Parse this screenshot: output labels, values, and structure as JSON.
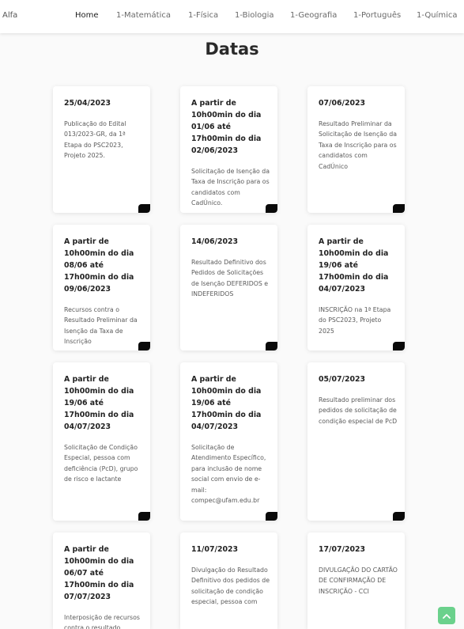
{
  "nav": {
    "brand": "Alfa",
    "links": [
      "Home",
      "1-Matemática",
      "1-Física",
      "1-Biologia",
      "1-Geografia",
      "1-Português",
      "1-Química"
    ]
  },
  "page": {
    "title": "Datas"
  },
  "cards": [
    {
      "date": "25/04/2023",
      "desc": "Publicação do Edital 013/2023-GR, da 1ª Etapa do PSC2023, Projeto 2025."
    },
    {
      "date": "A partir de 10h00min do dia 01/06 até 17h00min do dia 02/06/2023",
      "desc": "Solicitação de Isenção da Taxa de Inscrição para os candidatos com CadÚnico."
    },
    {
      "date": "07/06/2023",
      "desc": "Resultado Preliminar da Solicitação de Isenção da Taxa de Inscrição para os candidatos com CadÚnico"
    },
    {
      "date": "A partir de 10h00min do dia 08/06 até 17h00min do dia 09/06/2023",
      "desc": "Recursos contra o Resultado Preliminar da Isenção da Taxa de Inscrição"
    },
    {
      "date": "14/06/2023",
      "desc": "Resultado Definitivo dos Pedidos de Solicitações de Isenção DEFERIDOS e INDEFERIDOS"
    },
    {
      "date": "A partir de 10h00min do dia 19/06 até 17h00min do dia 04/07/2023",
      "desc": "INSCRIÇÃO na 1ª Etapa do PSC2023, Projeto 2025"
    },
    {
      "date": "A partir de 10h00min do dia 19/06 até 17h00min do dia 04/07/2023",
      "desc": "Solicitação de Condição Especial, pessoa com deficiência (PcD), grupo de risco e lactante"
    },
    {
      "date": "A partir de 10h00min do dia 19/06 até 17h00min do dia 04/07/2023",
      "desc": "Solicitação de Atendimento Específico, para inclusão de nome social com envio de e-mail: compec@ufam.edu.br"
    },
    {
      "date": "05/07/2023",
      "desc": "Resultado preliminar dos pedidos de solicitação de condição especial de PcD"
    },
    {
      "date": "A partir de 10h00min do dia 06/07 até 17h00min do dia 07/07/2023",
      "desc": "Interposição de recursos contra o resultado preliminar"
    },
    {
      "date": "11/07/2023",
      "desc": "Divulgação do Resultado Definitivo dos pedidos de solicitação de condição especial, pessoa com"
    },
    {
      "date": "17/07/2023",
      "desc": "DIVULGAÇÃO DO CARTÃO DE CONFIRMAÇÃO DE INSCRIÇÃO - CCI"
    }
  ]
}
